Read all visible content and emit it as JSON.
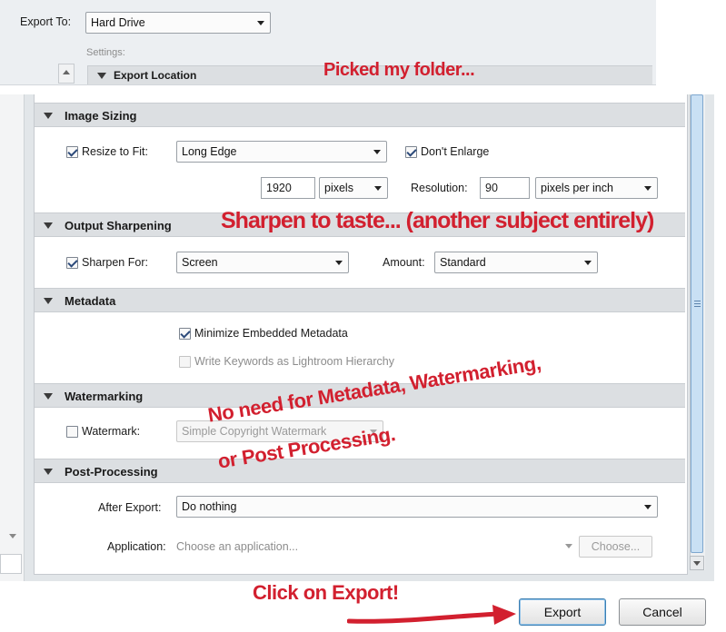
{
  "top": {
    "export_to_label": "Export To:",
    "export_to_value": "Hard Drive",
    "settings_label": "Settings:",
    "export_location_title": "Export Location"
  },
  "sections": {
    "image_sizing": "Image Sizing",
    "output_sharpening": "Output Sharpening",
    "metadata": "Metadata",
    "watermarking": "Watermarking",
    "post_processing": "Post-Processing"
  },
  "image_sizing": {
    "resize_label": "Resize to Fit:",
    "resize_value": "Long Edge",
    "dont_enlarge_label": "Don't Enlarge",
    "size_value": "1920",
    "size_unit": "pixels",
    "resolution_label": "Resolution:",
    "resolution_value": "90",
    "resolution_unit": "pixels per inch"
  },
  "output_sharpening": {
    "sharpen_for_label": "Sharpen For:",
    "sharpen_for_value": "Screen",
    "amount_label": "Amount:",
    "amount_value": "Standard"
  },
  "metadata": {
    "minimize_label": "Minimize Embedded Metadata",
    "keywords_label": "Write Keywords as Lightroom Hierarchy"
  },
  "watermarking": {
    "watermark_label": "Watermark:",
    "watermark_value": "Simple Copyright Watermark"
  },
  "post_processing": {
    "after_export_label": "After Export:",
    "after_export_value": "Do nothing",
    "application_label": "Application:",
    "application_placeholder": "Choose an application...",
    "choose_button": "Choose..."
  },
  "buttons": {
    "export": "Export",
    "cancel": "Cancel"
  },
  "annotations": {
    "picked_folder": "Picked my folder...",
    "sharpen": "Sharpen to taste... (another subject entirely)",
    "no_need_line1": "No need for Metadata, Watermarking,",
    "no_need_line2": "or Post Processing.",
    "click_export": "Click on Export!"
  },
  "colors": {
    "annotation_red": "#d2202f",
    "section_header_bg": "#dcdfe2",
    "scroll_thumb": "#c9e0f4"
  }
}
